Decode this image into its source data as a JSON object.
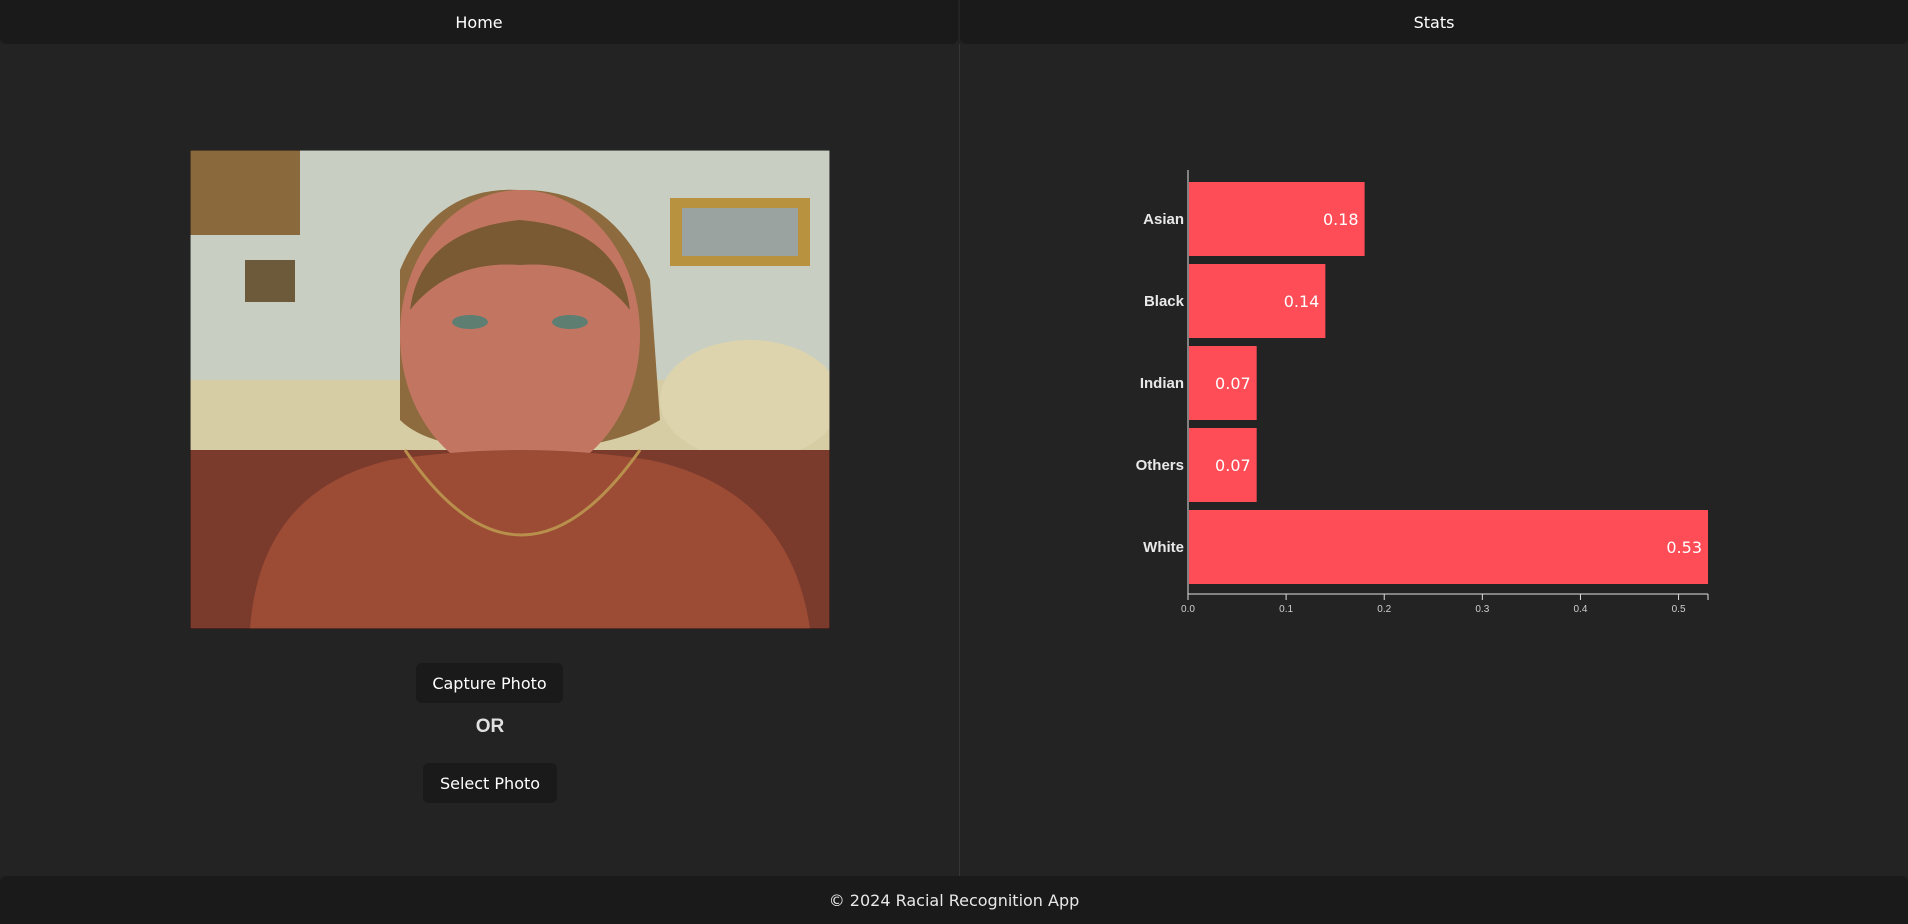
{
  "nav": {
    "home_label": "Home",
    "stats_label": "Stats"
  },
  "actions": {
    "capture_label": "Capture Photo",
    "or_label": "OR",
    "select_label": "Select Photo"
  },
  "footer": {
    "text": "© 2024 Racial Recognition App"
  },
  "colors": {
    "bar": "#ff4d57",
    "background": "#232323",
    "bar_label": "#ffffff"
  },
  "chart_data": {
    "type": "bar",
    "orientation": "horizontal",
    "categories": [
      "Asian",
      "Black",
      "Indian",
      "Others",
      "White"
    ],
    "values": [
      0.18,
      0.14,
      0.07,
      0.07,
      0.53
    ],
    "value_labels": [
      "0.18",
      "0.14",
      "0.07",
      "0.07",
      "0.53"
    ],
    "xticks": [
      "0.0",
      "0.1",
      "0.2",
      "0.3",
      "0.4",
      "0.5"
    ],
    "xlim": [
      0,
      0.53
    ],
    "grid": false,
    "title": "",
    "xlabel": "",
    "ylabel": ""
  }
}
